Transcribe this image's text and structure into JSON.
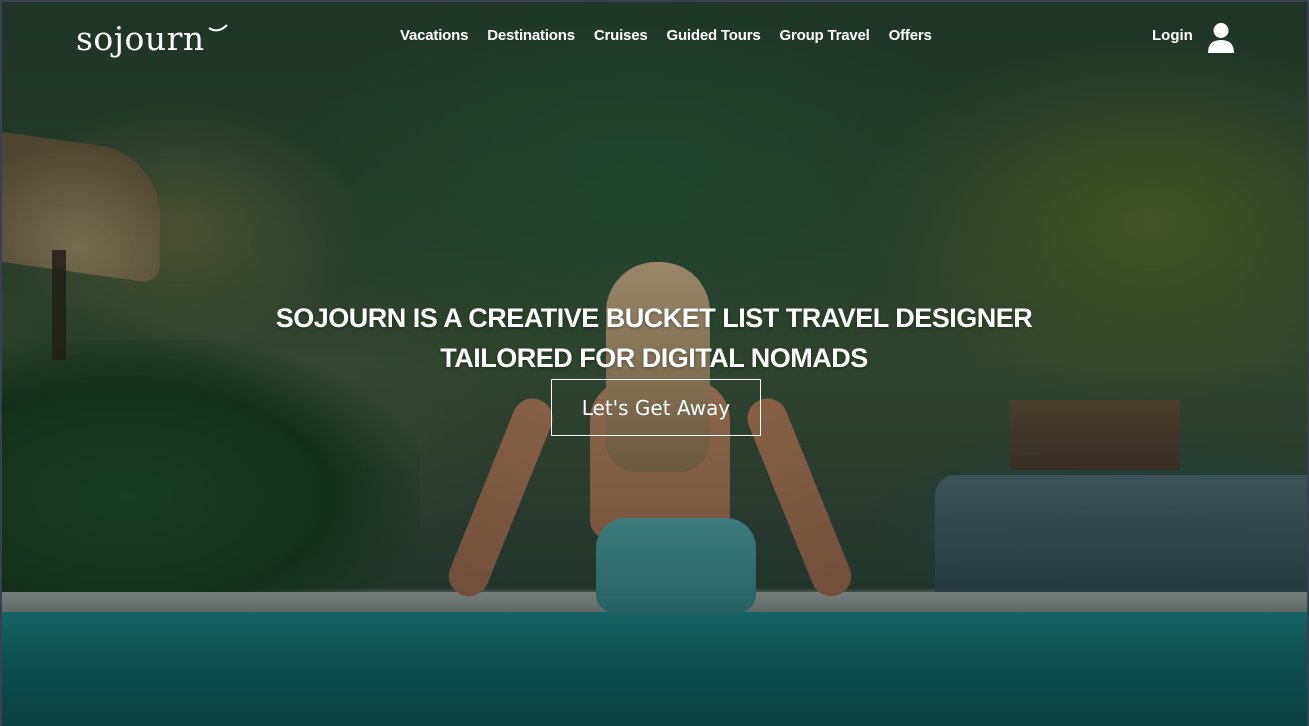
{
  "brand": {
    "logo_text": "sojourn"
  },
  "nav": {
    "items": [
      {
        "label": "Vacations"
      },
      {
        "label": "Destinations"
      },
      {
        "label": "Cruises"
      },
      {
        "label": "Guided Tours"
      },
      {
        "label": "Group Travel"
      },
      {
        "label": "Offers"
      }
    ]
  },
  "account": {
    "login_label": "Login",
    "icon": "user-icon"
  },
  "hero": {
    "headline_line1": "Sojourn is a creative bucket list travel designer",
    "headline_line2": "tailored for digital nomads",
    "cta_label": "Let's Get Away"
  },
  "colors": {
    "text": "#ffffff",
    "pool": "#0f6a6d",
    "jungle": "#2d4a33"
  }
}
